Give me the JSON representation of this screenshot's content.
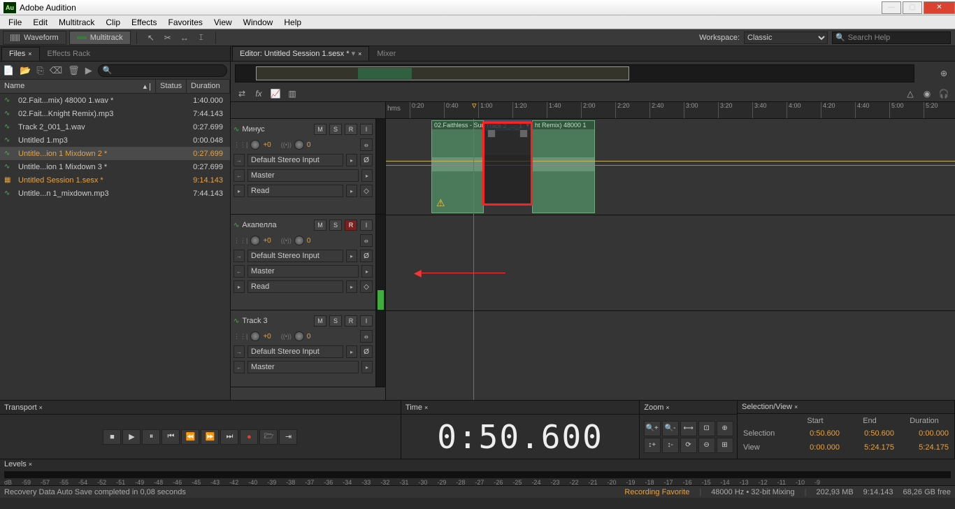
{
  "app": {
    "title": "Adobe Audition",
    "logo": "Au"
  },
  "menu": [
    "File",
    "Edit",
    "Multitrack",
    "Clip",
    "Effects",
    "Favorites",
    "View",
    "Window",
    "Help"
  ],
  "modes": {
    "waveform": "Waveform",
    "multitrack": "Multitrack"
  },
  "workspace": {
    "label": "Workspace:",
    "value": "Classic"
  },
  "search": {
    "placeholder": "Search Help"
  },
  "filesPanel": {
    "tabs": [
      "Files",
      "Effects Rack"
    ],
    "columns": {
      "name": "Name",
      "status": "Status",
      "duration": "Duration"
    },
    "rows": [
      {
        "icon": "wave",
        "name": "02.Fait...mix) 48000 1.wav *",
        "dur": "1:40.000"
      },
      {
        "icon": "wave",
        "name": "02.Fait...Knight Remix).mp3",
        "dur": "7:44.143"
      },
      {
        "icon": "wave",
        "name": "Track 2_001_1.wav",
        "dur": "0:27.699"
      },
      {
        "icon": "wave",
        "name": "Untitled 1.mp3",
        "dur": "0:00.048"
      },
      {
        "icon": "wave",
        "name": "Untitle...ion 1 Mixdown 2 *",
        "dur": "0:27.699",
        "sel": true
      },
      {
        "icon": "wave",
        "name": "Untitle...ion 1 Mixdown 3 *",
        "dur": "0:27.699"
      },
      {
        "icon": "sess",
        "name": "Untitled Session 1.sesx *",
        "dur": "9:14.143",
        "hl": true
      },
      {
        "icon": "wave",
        "name": "Untitle...n 1_mixdown.mp3",
        "dur": "7:44.143"
      }
    ]
  },
  "editor": {
    "tabs": [
      {
        "label": "Editor: Untitled Session 1.sesx *",
        "active": true
      },
      {
        "label": "Mixer"
      }
    ],
    "ruler_hms": "hms",
    "ticks": [
      "0:20",
      "0:40",
      "1:00",
      "1:20",
      "1:40",
      "2:00",
      "2:20",
      "2:40",
      "3:00",
      "3:20",
      "3:40",
      "4:00",
      "4:20",
      "4:40",
      "5:00",
      "5:20"
    ],
    "clips": {
      "c1": "02.Faithless - Sun",
      "c2": "Track 2_..._1",
      "c3": "ht Remix) 48000 1"
    }
  },
  "tracks": [
    {
      "name": "Минус",
      "vol": "+0",
      "pan": "0",
      "input": "Default Stereo Input",
      "output": "Master",
      "auto": "Read",
      "rec": false
    },
    {
      "name": "Акапелла",
      "vol": "+0",
      "pan": "0",
      "input": "Default Stereo Input",
      "output": "Master",
      "auto": "Read",
      "rec": true
    },
    {
      "name": "Track 3",
      "vol": "+0",
      "pan": "0",
      "input": "Default Stereo Input",
      "output": "Master",
      "rec": false
    }
  ],
  "trackBtns": {
    "m": "M",
    "s": "S",
    "r": "R",
    "i": "I"
  },
  "transport": {
    "title": "Transport"
  },
  "time": {
    "title": "Time",
    "value": "0:50.600"
  },
  "zoom": {
    "title": "Zoom"
  },
  "selview": {
    "title": "Selection/View",
    "cols": [
      "Start",
      "End",
      "Duration"
    ],
    "rows": [
      {
        "label": "Selection",
        "start": "0:50.600",
        "end": "0:50.600",
        "dur": "0:00.000"
      },
      {
        "label": "View",
        "start": "0:00.000",
        "end": "5:24.175",
        "dur": "5:24.175"
      }
    ]
  },
  "levels": {
    "title": "Levels",
    "scale": [
      "dB",
      "-59",
      "-57",
      "-55",
      "-54",
      "-52",
      "-51",
      "-49",
      "-48",
      "-46",
      "-45",
      "-43",
      "-42",
      "-40",
      "-39",
      "-38",
      "-37",
      "-36",
      "-34",
      "-33",
      "-32",
      "-31",
      "-30",
      "-29",
      "-28",
      "-27",
      "-26",
      "-25",
      "-24",
      "-23",
      "-22",
      "-21",
      "-20",
      "-19",
      "-18",
      "-17",
      "-16",
      "-15",
      "-14",
      "-13",
      "-12",
      "-11",
      "-10",
      "-9"
    ]
  },
  "status": {
    "msg": "Recovery Data Auto Save completed in 0,08 seconds",
    "recfav": "Recording Favorite",
    "format": "48000 Hz • 32-bit Mixing",
    "mem": "202,93 MB",
    "sessdur": "9:14.143",
    "disk": "68,26 GB free"
  }
}
